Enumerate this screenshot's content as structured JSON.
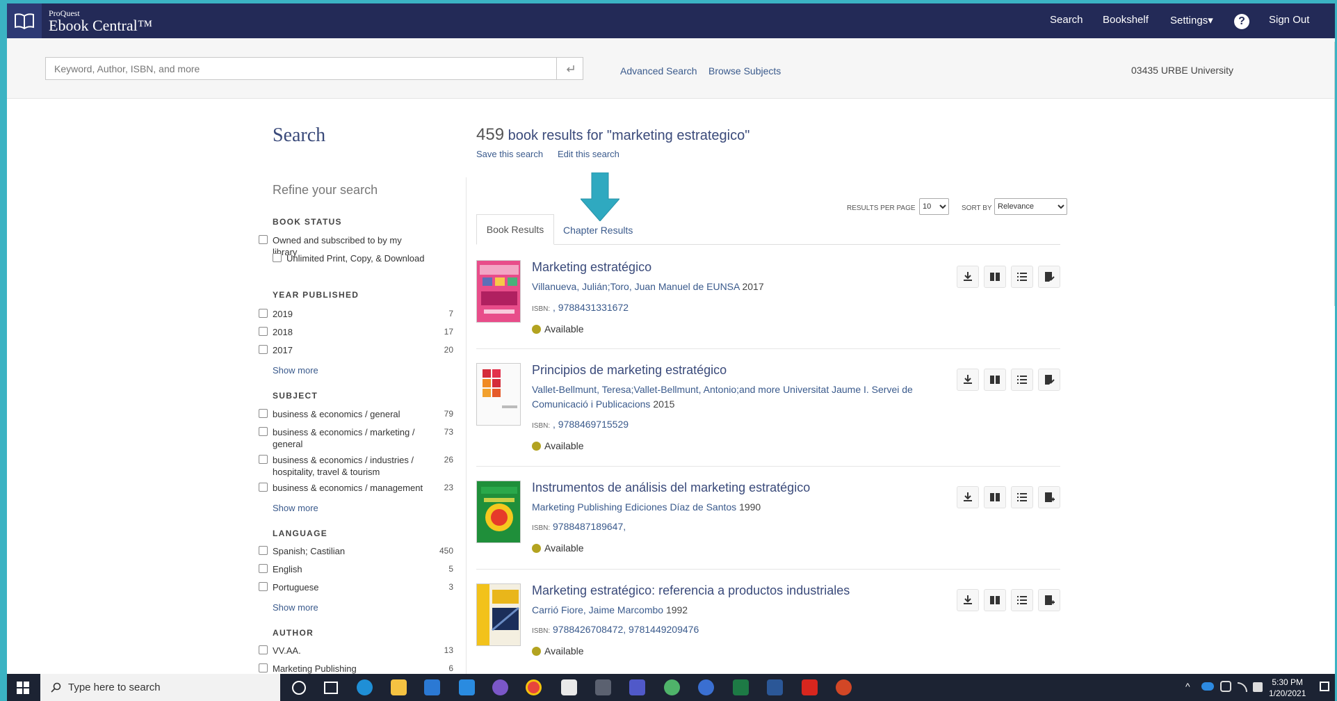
{
  "brand": {
    "small": "ProQuest",
    "main": "Ebook Central™"
  },
  "nav": {
    "search": "Search",
    "bookshelf": "Bookshelf",
    "settings": "Settings▾",
    "help": "?",
    "signout": "Sign Out"
  },
  "searchbar": {
    "placeholder": "Keyword, Author, ISBN, and more",
    "advanced": "Advanced Search",
    "browse": "Browse Subjects",
    "institution": "03435 URBE University"
  },
  "sidebar": {
    "title": "Search",
    "refine": "Refine your search",
    "book_status": {
      "heading": "BOOK STATUS",
      "items": [
        "Owned and subscribed to by my library",
        "Unlimited Print, Copy, & Download"
      ]
    },
    "year": {
      "heading": "YEAR PUBLISHED",
      "items": [
        {
          "label": "2019",
          "count": "7"
        },
        {
          "label": "2018",
          "count": "17"
        },
        {
          "label": "2017",
          "count": "20"
        }
      ],
      "more": "Show more"
    },
    "subject": {
      "heading": "SUBJECT",
      "items": [
        {
          "label": "business & economics / general",
          "count": "79"
        },
        {
          "label": "business & economics / marketing / general",
          "count": "73"
        },
        {
          "label": "business & economics / industries / hospitality, travel & tourism",
          "count": "26"
        },
        {
          "label": "business & economics / management",
          "count": "23"
        }
      ],
      "more": "Show more"
    },
    "language": {
      "heading": "LANGUAGE",
      "items": [
        {
          "label": "Spanish; Castilian",
          "count": "450"
        },
        {
          "label": "English",
          "count": "5"
        },
        {
          "label": "Portuguese",
          "count": "3"
        }
      ],
      "more": "Show more"
    },
    "author": {
      "heading": "AUTHOR",
      "items": [
        {
          "label": "VV.AA.",
          "count": "13"
        },
        {
          "label": "Marketing Publishing",
          "count": "6"
        }
      ]
    }
  },
  "results": {
    "count": "459",
    "text": "book results for \"marketing estrategico\"",
    "save": "Save this search",
    "edit": "Edit this search",
    "rpp_label": "RESULTS PER PAGE",
    "rpp_value": "10",
    "sort_label": "SORT BY",
    "sort_value": "Relevance",
    "tabs": [
      "Book Results",
      "Chapter Results"
    ],
    "items": [
      {
        "title": "Marketing estratégico",
        "authors": "Villanueva, Julián;Toro, Juan Manuel de  EUNSA",
        "year": "2017",
        "isbn": ", 9788431331672",
        "status": "Available"
      },
      {
        "title": "Principios de marketing estratégico",
        "authors": "Vallet-Bellmunt, Teresa;Vallet-Bellmunt, Antonio;and more  Universitat Jaume I. Servei de Comunicació i Publicacions",
        "year": "2015",
        "isbn": ", 9788469715529",
        "status": "Available"
      },
      {
        "title": "Instrumentos de análisis del marketing estratégico",
        "authors": "Marketing Publishing  Ediciones Díaz de Santos",
        "year": "1990",
        "isbn": "9788487189647,",
        "status": "Available"
      },
      {
        "title": "Marketing estratégico: referencia a productos industriales",
        "authors": "Carrió Fiore, Jaime  Marcombo",
        "year": "1992",
        "isbn": "9788426708472, 9781449209476",
        "status": "Available"
      }
    ],
    "isbn_label": "ISBN:"
  },
  "taskbar": {
    "search": "Type here to search",
    "time": "5:30 PM",
    "date": "1/20/2021"
  },
  "colors": {
    "nav_bg": "#232a57",
    "link": "#3a5a8c",
    "title": "#3a4a7a",
    "arrow": "#2fa9c0",
    "available": "#b3a320"
  }
}
